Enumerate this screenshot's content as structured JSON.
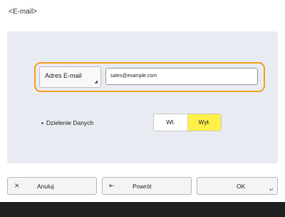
{
  "screen": {
    "title": "<E-mail>"
  },
  "email": {
    "label": "Adres E-mail",
    "value": "sales@example.com"
  },
  "data_sharing": {
    "label": "Dzielenie Danych",
    "options": [
      "Wł.",
      "Wył."
    ],
    "selected": "Wył."
  },
  "footer": {
    "cancel": "Anuluj",
    "back": "Powrót",
    "ok": "OK"
  },
  "colors": {
    "highlight": "#f0a020",
    "selected": "#fff04a",
    "panel": "#e9ebf2",
    "bullet": "#2a6fd6"
  },
  "icons": {
    "cancel": "close-icon",
    "back": "arrow-left-icon",
    "ok": "enter-icon",
    "field": "corner-arrow-icon"
  }
}
